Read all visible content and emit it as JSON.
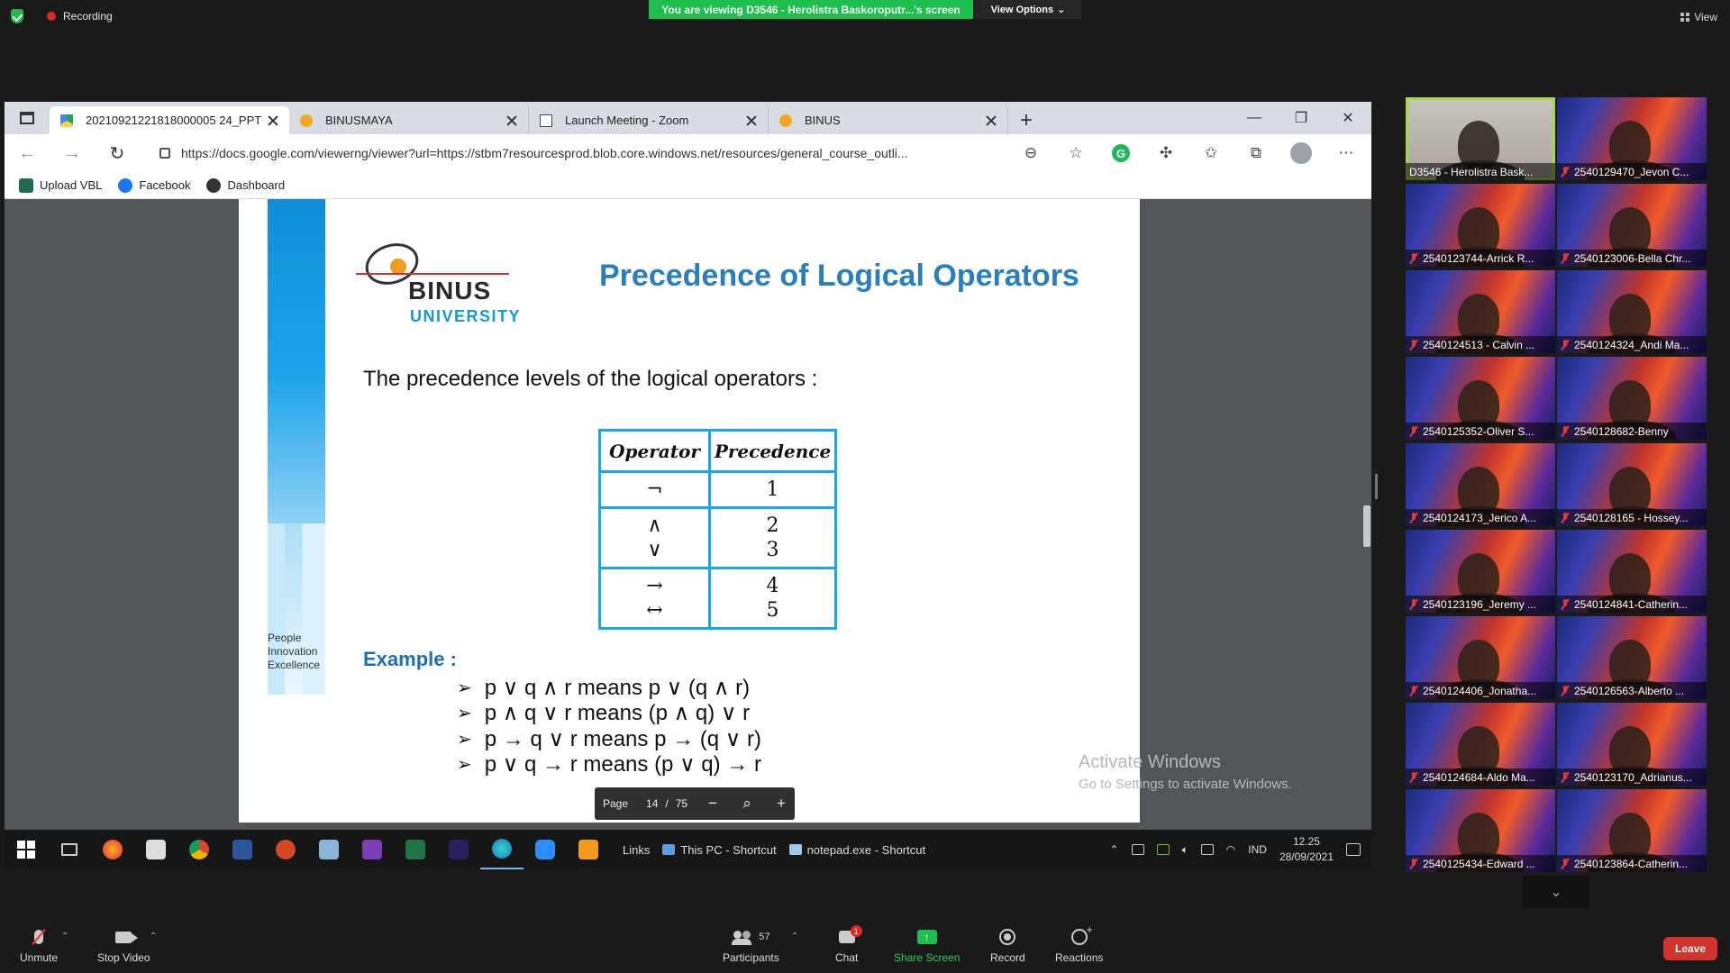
{
  "zoom": {
    "recording_label": "Recording",
    "viewing_banner": "You are viewing D3546 - Herolistra Baskoroputr...'s screen",
    "view_options": "View Options",
    "view_label": "View",
    "leave": "Leave",
    "toolbar": {
      "unmute": "Unmute",
      "stop_video": "Stop Video",
      "participants": "Participants",
      "participants_count": "57",
      "chat": "Chat",
      "chat_badge": "1",
      "share_screen": "Share Screen",
      "record": "Record",
      "reactions": "Reactions"
    },
    "participants": [
      {
        "name": "D3546 - Herolistra Bask...",
        "camera": true,
        "selected": true
      },
      {
        "name": "2540129470_Jevon C..."
      },
      {
        "name": "2540123744-Arrick R..."
      },
      {
        "name": "2540123006-Bella Chr..."
      },
      {
        "name": "2540124513 - Calvin ..."
      },
      {
        "name": "2540124324_Andi Ma..."
      },
      {
        "name": "2540125352-Oliver S..."
      },
      {
        "name": "2540128682-Benny"
      },
      {
        "name": "2540124173_Jerico A..."
      },
      {
        "name": "2540128165 - Hossey..."
      },
      {
        "name": "2540123196_Jeremy ..."
      },
      {
        "name": "2540124841-Catherin..."
      },
      {
        "name": "2540124406_Jonatha..."
      },
      {
        "name": "2540126563-Alberto ..."
      },
      {
        "name": "2540124684-Aldo Ma..."
      },
      {
        "name": "2540123170_Adrianus..."
      },
      {
        "name": "2540125434-Edward ..."
      },
      {
        "name": "2540123864-Catherin..."
      }
    ]
  },
  "browser": {
    "tabs": [
      {
        "title": "20210921221818000005 24_PPT",
        "active": true
      },
      {
        "title": "BINUSMAYA"
      },
      {
        "title": "Launch Meeting - Zoom"
      },
      {
        "title": "BINUS"
      }
    ],
    "url": "https://docs.google.com/viewerng/viewer?url=https://stbm7resourcesprod.blob.core.windows.net/resources/general_course_outli...",
    "bookmarks": [
      "Upload VBL",
      "Facebook",
      "Dashboard"
    ],
    "pager": {
      "label": "Page",
      "current": "14",
      "separator": "/",
      "total": "75"
    }
  },
  "slide": {
    "logo_name": "BINUS",
    "logo_sub": "UNIVERSITY",
    "tagline": [
      "People",
      "Innovation",
      "Excellence"
    ],
    "title": "Precedence of Logical Operators",
    "intro": "The precedence levels of the logical operators :",
    "table": {
      "headers": [
        "Operator",
        "Precedence"
      ],
      "rows": [
        {
          "ops": [
            "¬"
          ],
          "prec": [
            "1"
          ]
        },
        {
          "ops": [
            "∧",
            "∨"
          ],
          "prec": [
            "2",
            "3"
          ]
        },
        {
          "ops": [
            "→",
            "↔"
          ],
          "prec": [
            "4",
            "5"
          ]
        }
      ]
    },
    "example_heading": "Example :",
    "examples": [
      "p ∨ q ∧ r means p ∨ (q ∧ r)",
      "p ∧ q ∨ r means (p ∧ q) ∨ r",
      "p → q ∨ r means p → (q ∨ r)",
      "p ∨ q → r means (p ∨ q) → r"
    ]
  },
  "windows": {
    "activate_title": "Activate Windows",
    "activate_sub": "Go to Settings to activate Windows.",
    "taskbar_links": "Links",
    "taskbar_thispc": "This PC - Shortcut",
    "taskbar_notepad": "notepad.exe - Shortcut",
    "lang": "IND",
    "time": "12.25",
    "date": "28/09/2021"
  }
}
